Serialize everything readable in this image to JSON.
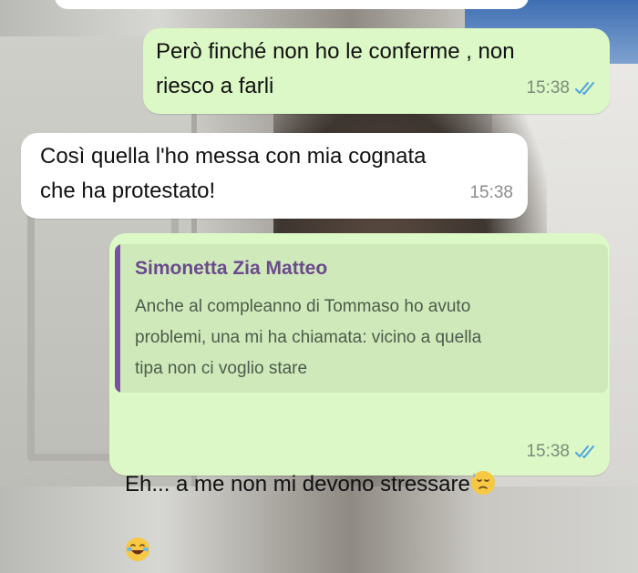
{
  "messages": [
    {
      "direction": "outgoing",
      "text": "Però finché non ho le conferme , non\nriesco a farli",
      "time": "15:38",
      "read_status": "read"
    },
    {
      "direction": "incoming",
      "text": "Così quella l'ho messa con mia cognata\nche ha protestato!",
      "time": "15:38"
    },
    {
      "direction": "outgoing",
      "quoted": {
        "author": "Simonetta Zia Matteo",
        "text": "Anche al compleanno di Tommaso ho avuto\nproblemi,  una mi ha chiamata: vicino a quella\ntipa non ci voglio stare"
      },
      "text": "Eh... a me non mi devono stressare",
      "emojis": [
        "downcast-face-with-sweat-emoji",
        "face-with-tears-of-joy-emoji"
      ],
      "time": "15:38",
      "read_status": "read"
    }
  ],
  "colors": {
    "outgoing_bubble": "#dcf8c6",
    "incoming_bubble": "#ffffff",
    "read_ticks": "#4fa3e0",
    "quote_bar": "#7b4fa2"
  }
}
